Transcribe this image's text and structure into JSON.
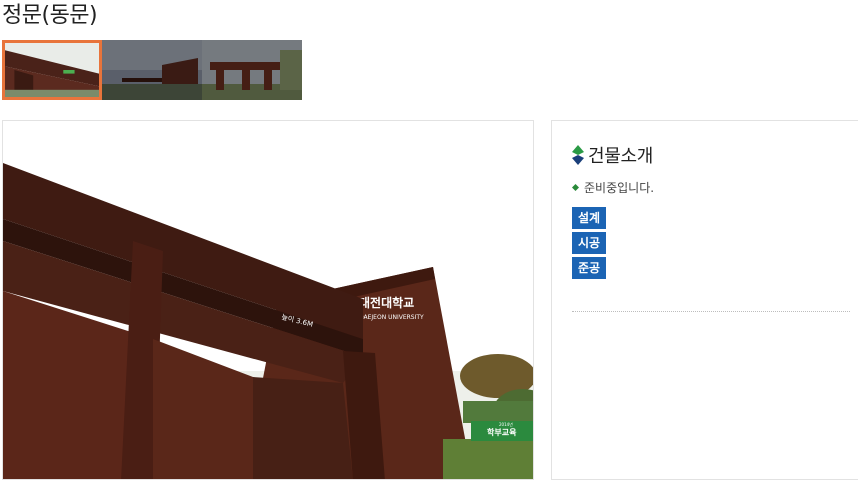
{
  "page": {
    "title": "정문(동문)"
  },
  "gallery": {
    "thumbnails": [
      {
        "name": "thumb-1",
        "active": true
      },
      {
        "name": "thumb-2",
        "active": false
      },
      {
        "name": "thumb-3",
        "active": false
      }
    ]
  },
  "main_photo": {
    "sign_text_ko": "대전대학교",
    "sign_text_en": "DAEJEON UNIVERSITY",
    "clearance_text": "높이 3.6M",
    "banner_text": "학부교육",
    "banner_small": "2014년"
  },
  "info": {
    "heading_icon": "diamond-icon",
    "heading": "건물소개",
    "bullet_icon": "diamond-bullet-icon",
    "description": "준비중입니다.",
    "stages": [
      {
        "label": "설계"
      },
      {
        "label": "시공"
      },
      {
        "label": "준공"
      }
    ]
  },
  "colors": {
    "accent_blue": "#1b64b4",
    "thumb_active_border": "#e8743b",
    "brand_green": "#2a8a3a"
  }
}
